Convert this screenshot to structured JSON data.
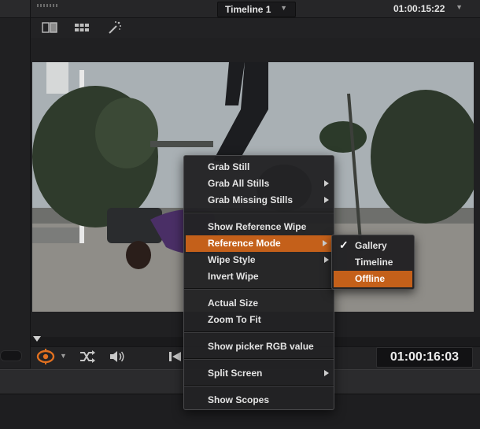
{
  "header": {
    "timeline_name": "Timeline 1",
    "timecode": "01:00:15:22"
  },
  "toolbar": {
    "icons": [
      "split-view-icon",
      "grid-view-icon",
      "magic-wand-icon"
    ]
  },
  "transport": {
    "timecode": "01:00:16:03",
    "icons": [
      "highlight-tool-icon",
      "shuffle-icon",
      "speaker-icon",
      "skip-back-icon"
    ]
  },
  "context_menu": {
    "items": [
      {
        "label": "Grab Still",
        "submenu": false
      },
      {
        "label": "Grab All Stills",
        "submenu": true
      },
      {
        "label": "Grab Missing Stills",
        "submenu": true
      },
      {
        "label": "Show Reference Wipe",
        "submenu": false
      },
      {
        "label": "Reference Mode",
        "submenu": true,
        "highlighted": true
      },
      {
        "label": "Wipe Style",
        "submenu": true
      },
      {
        "label": "Invert Wipe",
        "submenu": false
      },
      {
        "label": "Actual Size",
        "submenu": false
      },
      {
        "label": "Zoom To Fit",
        "submenu": false
      },
      {
        "label": "Show picker RGB value",
        "submenu": false
      },
      {
        "label": "Split Screen",
        "submenu": true
      },
      {
        "label": "Show Scopes",
        "submenu": false
      }
    ]
  },
  "reference_mode_submenu": {
    "items": [
      {
        "label": "Gallery",
        "checked": true
      },
      {
        "label": "Timeline",
        "checked": false
      },
      {
        "label": "Offline",
        "checked": false,
        "highlighted": true
      }
    ]
  },
  "colors": {
    "highlight": "#c4601a",
    "background": "#1c1c1e"
  }
}
